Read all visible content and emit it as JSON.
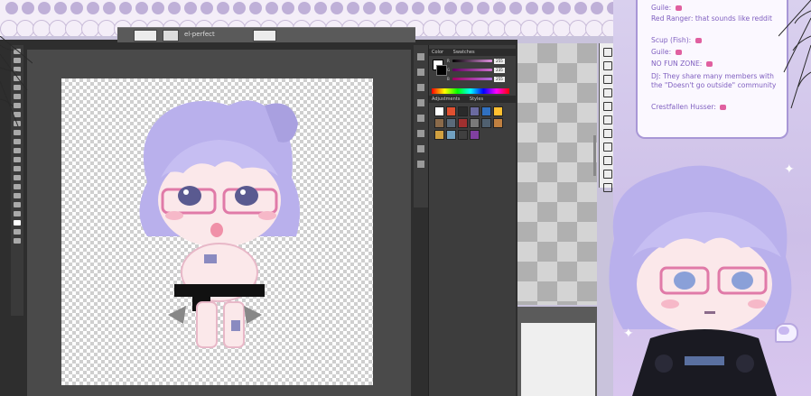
{
  "app": {
    "topbar_zoom": "",
    "topbar_mode": "el-perfect"
  },
  "photoshop": {
    "panel_tabs": [
      "Color",
      "Swatches"
    ],
    "adjust_tabs": [
      "Adjustments",
      "Styles"
    ],
    "sliders": [
      {
        "label": "R",
        "value": "255",
        "color": "#e090e0"
      },
      {
        "label": "G",
        "value": "235",
        "color": "#d070d0"
      },
      {
        "label": "B",
        "value": "255",
        "color": "#b070e0"
      }
    ],
    "style_swatches": [
      "#ffffff",
      "#e05030",
      "#2a2a2a",
      "#6a6aa0",
      "#3070c0",
      "#ffc030",
      "#8a6a4a",
      "#5a6a7a",
      "#a03030",
      "#7a7a7a",
      "#506070",
      "#c08040",
      "#d0a040",
      "#70a0c0",
      "#404040",
      "#8040a0"
    ]
  },
  "chat": {
    "messages": [
      {
        "name": "Guile:",
        "text": "",
        "heart": true
      },
      {
        "name": "Red Ranger:",
        "text": "that sounds like reddit",
        "heart": false
      },
      {
        "name": "Scup (Fish):",
        "text": "",
        "heart": true
      },
      {
        "name": "Guile:",
        "text": "",
        "heart": true
      },
      {
        "name": "NO FUN ZONE:",
        "text": "",
        "heart": true
      },
      {
        "name": "DJ:",
        "text": "They share many members with the \"Doesn't go outside\" community",
        "heart": false
      },
      {
        "name": "Crestfallen Husser:",
        "text": "",
        "heart": true
      }
    ]
  },
  "colors": {
    "accent": "#8060c0",
    "hair": "#b9b0ec",
    "skin": "#fbe8ea",
    "workspace": "#2e2e2e"
  }
}
